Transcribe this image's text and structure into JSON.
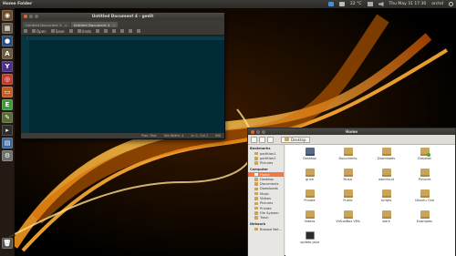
{
  "top_panel": {
    "app_title": "Home Folder",
    "temperature": "22 °C",
    "datetime": "Thu May 31 17:30",
    "user": "archd"
  },
  "launcher": {
    "items": [
      {
        "name": "dash-home",
        "color": "#6b4a2a",
        "glyph": "◉"
      },
      {
        "name": "nautilus",
        "color": "#5d5448",
        "glyph": "▦"
      },
      {
        "name": "firefox",
        "color": "#2a4f7a",
        "glyph": "●"
      },
      {
        "name": "software-center",
        "color": "#6c5a3f",
        "glyph": "A"
      },
      {
        "name": "yahoo",
        "color": "#4b2f8a",
        "glyph": "Y"
      },
      {
        "name": "ubuntu-one",
        "color": "#c0392b",
        "glyph": "◎"
      },
      {
        "name": "shopping",
        "color": "#c45b1f",
        "glyph": "▭"
      },
      {
        "name": "evernote",
        "color": "#3e9a3a",
        "glyph": "E"
      },
      {
        "name": "gedit",
        "color": "#5a6b3a",
        "glyph": "✎"
      },
      {
        "name": "terminal",
        "color": "#2d2d2d",
        "glyph": "▸"
      },
      {
        "name": "workspaces",
        "color": "#3b6a9a",
        "glyph": "▤"
      },
      {
        "name": "system-settings",
        "color": "#6f6f6f",
        "glyph": "⚙"
      },
      {
        "name": "trash",
        "color": "#555555",
        "glyph": "🗑"
      }
    ]
  },
  "gedit": {
    "title": "Untitled Document 4 - gedit",
    "tabs": [
      {
        "label": "Untitled Document 3",
        "active": false
      },
      {
        "label": "Untitled Document 4",
        "active": true
      }
    ],
    "toolbar": {
      "open": "Open",
      "save": "Save",
      "undo": "Undo"
    },
    "line_number": "1",
    "status": {
      "lang": "Plain Text",
      "tab": "Tab Width: 4",
      "pos": "Ln 1, Col 1",
      "mode": "INS"
    }
  },
  "nautilus": {
    "title": "Home",
    "breadcrumb": "Desktop",
    "bookmarks_header": "Bookmarks",
    "bookmarks": [
      "partition1",
      "partition2",
      "Pictures"
    ],
    "computer_header": "Computer",
    "computer": [
      "Home",
      "Desktop",
      "Documents",
      "Downloads",
      "Music",
      "Videos",
      "Pictures",
      "Private",
      "File System",
      "Trash"
    ],
    "network_header": "Network",
    "network": [
      "Browse Net..."
    ],
    "files": [
      {
        "label": "Desktop",
        "kind": "desk"
      },
      {
        "label": "Documents",
        "kind": "folder"
      },
      {
        "label": "Downloads",
        "kind": "folder"
      },
      {
        "label": "Dropbox",
        "kind": "dropbox"
      },
      {
        "label": "grive",
        "kind": "folder"
      },
      {
        "label": "Music",
        "kind": "folder"
      },
      {
        "label": "owncloud",
        "kind": "folder"
      },
      {
        "label": "Pictures",
        "kind": "folder"
      },
      {
        "label": "Private",
        "kind": "folder"
      },
      {
        "label": "Public",
        "kind": "folder"
      },
      {
        "label": "scripts",
        "kind": "folder"
      },
      {
        "label": "Ubuntu One",
        "kind": "folder"
      },
      {
        "label": "Videos",
        "kind": "folder"
      },
      {
        "label": "VirtualBox VMs",
        "kind": "folder"
      },
      {
        "label": "work",
        "kind": "folder"
      },
      {
        "label": "Examples",
        "kind": "folder"
      },
      {
        "label": "update-java",
        "kind": "term"
      }
    ]
  },
  "colors": {
    "editor_bg": "#002b36",
    "accent": "#f07746",
    "folder": "#c9a459"
  }
}
